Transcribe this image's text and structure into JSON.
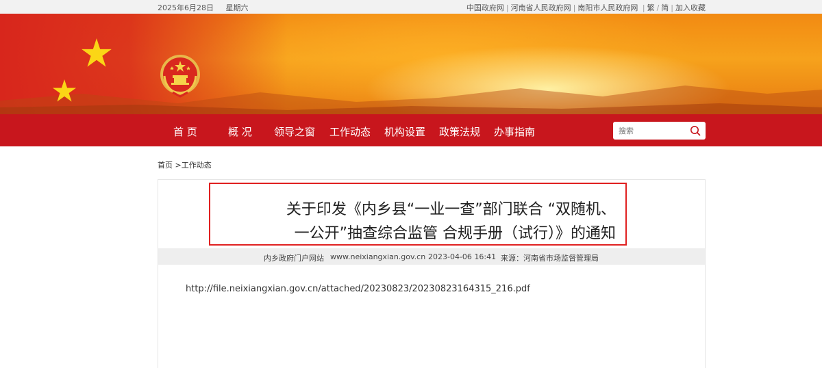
{
  "topbar": {
    "date": "2025年6月28日",
    "weekday": "星期六",
    "links": [
      "中国政府网",
      "河南省人民政府网",
      "南阳市人民政府网"
    ],
    "lang": "繁",
    "lang2": "简",
    "favorite": "加入收藏"
  },
  "nav": {
    "items": [
      "首 页",
      "概 况",
      "领导之窗",
      "工作动态",
      "机构设置",
      "政策法规",
      "办事指南"
    ],
    "search_placeholder": "搜索"
  },
  "breadcrumb": {
    "home": "首页",
    "current": ">工作动态"
  },
  "article": {
    "title_line1": "关于印发《内乡县“一业一查”部门联合 “双随机、",
    "title_line2": "一公开”抽查综合监管 合规手册（试行）》的通知",
    "meta": {
      "site": "内乡政府门户网站",
      "url": "www.neixiangxian.gov.cn",
      "datetime": "2023-04-06 16:41",
      "source": "来源：河南省市场监督管理局"
    },
    "content_link": "http://file.neixiangxian.gov.cn/attached/20230823/20230823164315_216.pdf"
  },
  "icons": {
    "search": "search-icon",
    "emblem": "national-emblem-icon",
    "star": "star-icon"
  },
  "colors": {
    "nav_red": "#c8161d",
    "title_border": "#e02020",
    "banner_orange": "#f28a12"
  }
}
